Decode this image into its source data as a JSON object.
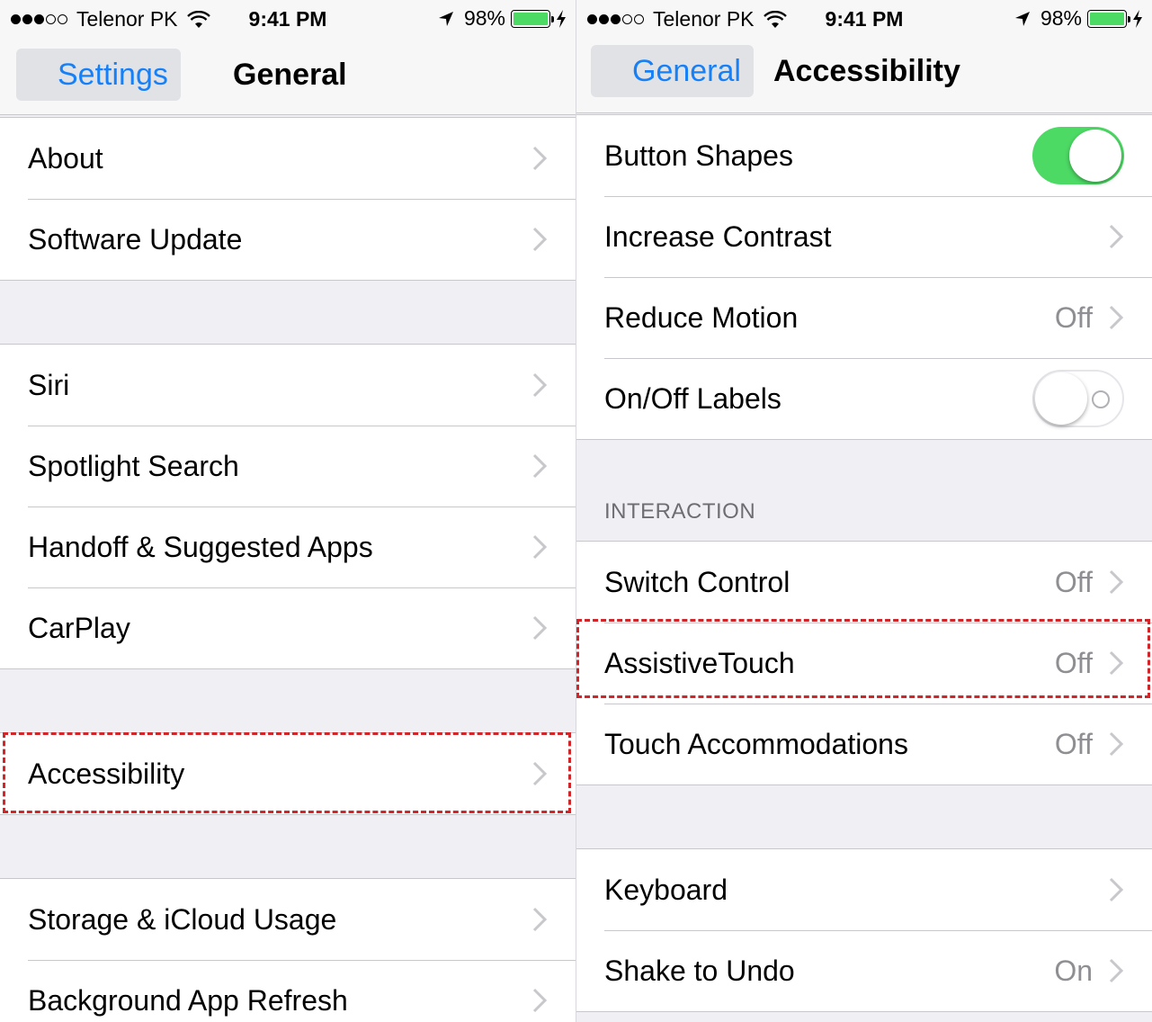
{
  "colors": {
    "accent": "#1580f8",
    "switch_on": "#4cd964",
    "highlight": "#d0262a"
  },
  "status_bar": {
    "left": {
      "signal_dots": [
        true,
        true,
        true,
        false,
        false
      ],
      "carrier": "Telenor PK",
      "time": "9:41 PM",
      "battery_pct": "98%"
    },
    "right": {
      "signal_dots": [
        true,
        true,
        true,
        false,
        false
      ],
      "carrier": "Telenor PK",
      "time": "9:41 PM",
      "battery_pct": "98%"
    }
  },
  "left_screen": {
    "back_label": "Settings",
    "title": "General",
    "groups": [
      [
        {
          "label": "About"
        },
        {
          "label": "Software Update"
        }
      ],
      [
        {
          "label": "Siri"
        },
        {
          "label": "Spotlight Search"
        },
        {
          "label": "Handoff & Suggested Apps"
        },
        {
          "label": "CarPlay"
        }
      ],
      [
        {
          "label": "Accessibility"
        }
      ],
      [
        {
          "label": "Storage & iCloud Usage"
        },
        {
          "label": "Background App Refresh"
        }
      ]
    ]
  },
  "right_screen": {
    "back_label": "General",
    "title": "Accessibility",
    "group1": [
      {
        "label": "Button Shapes",
        "switch": "on"
      },
      {
        "label": "Increase Contrast"
      },
      {
        "label": "Reduce Motion",
        "value": "Off"
      },
      {
        "label": "On/Off Labels",
        "switch": "off"
      }
    ],
    "interaction_header": "INTERACTION",
    "group2": [
      {
        "label": "Switch Control",
        "value": "Off"
      },
      {
        "label": "AssistiveTouch",
        "value": "Off"
      },
      {
        "label": "Touch Accommodations",
        "value": "Off"
      }
    ],
    "group3": [
      {
        "label": "Keyboard"
      },
      {
        "label": "Shake to Undo",
        "value": "On"
      }
    ]
  }
}
